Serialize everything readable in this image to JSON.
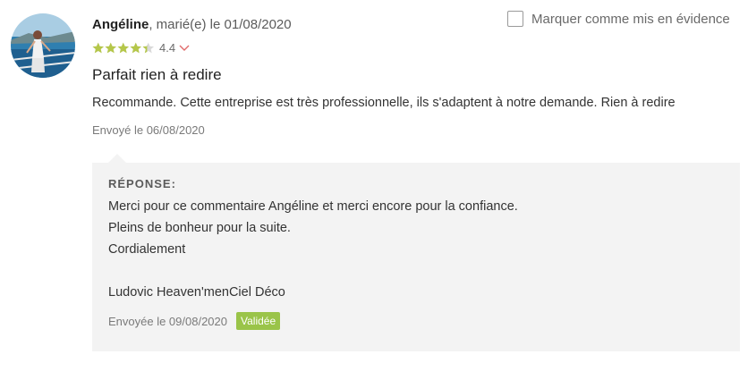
{
  "review": {
    "author": "Angéline",
    "meta": ", marié(e) le 01/08/2020",
    "rating": 4.4,
    "rating_label": "4.4",
    "stars_icon": "star-icon",
    "title": "Parfait rien à redire",
    "body": "Recommande. Cette entreprise est très professionnelle, ils s'adaptent à notre demande. Rien à redire",
    "sent_date": "Envoyé le 06/08/2020"
  },
  "highlight": {
    "label": "Marquer comme mis en évidence",
    "checked": false
  },
  "response": {
    "heading": "RÉPONSE:",
    "lines": [
      "Merci pour ce commentaire Angéline et merci encore pour la confiance.",
      "Pleins de bonheur pour la suite.",
      "Cordialement",
      "",
      "Ludovic Heaven'menCiel Déco"
    ],
    "sent_date": "Envoyée le 09/08/2020",
    "status_badge": "Validée"
  },
  "colors": {
    "star": "#b5c74a",
    "badge": "#9ac449",
    "chevron": "#e06a6a",
    "response_bg": "#f3f3f3"
  }
}
